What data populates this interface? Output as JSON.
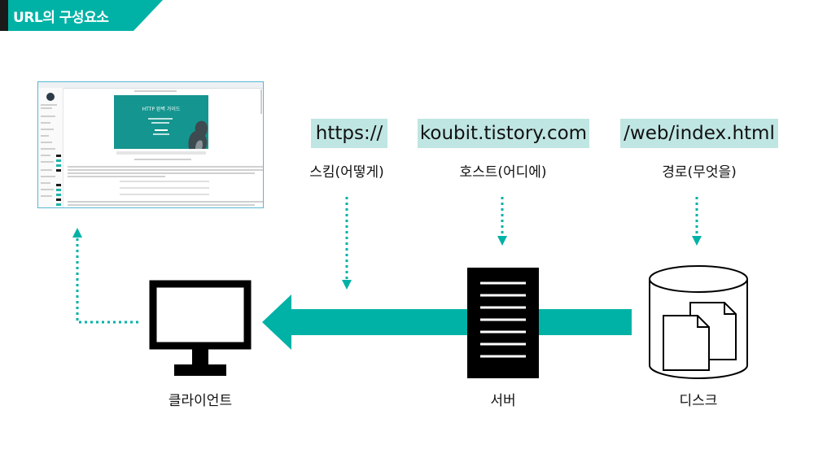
{
  "header": {
    "title": "URL의 구성요소"
  },
  "parts": [
    {
      "label": "https://",
      "caption": "스킴(어떻게)"
    },
    {
      "label": "koubit.tistory.com",
      "caption": "호스트(어디에)"
    },
    {
      "label": "/web/index.html",
      "caption": "경로(무엇을)"
    }
  ],
  "nodes": {
    "client": "클라이언트",
    "server": "서버",
    "disk": "디스크"
  },
  "screenshot": {
    "banner_title": "HTTP 완벽 가이드"
  },
  "colors": {
    "accent": "#00b2a6",
    "label_bg": "#bfe6e3",
    "dark": "#000000"
  }
}
